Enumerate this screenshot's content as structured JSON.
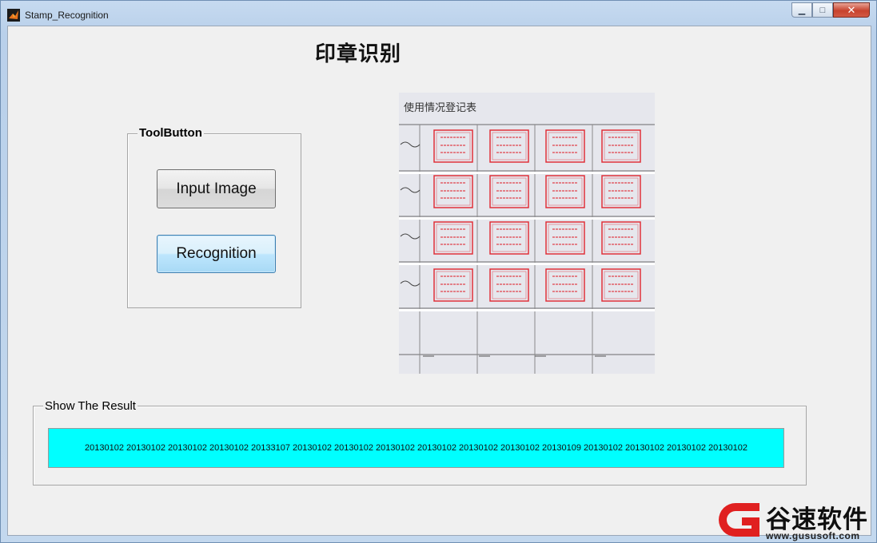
{
  "window": {
    "title": "Stamp_Recognition",
    "controls": {
      "minimize": "▁",
      "maximize": "□",
      "close": "✕"
    }
  },
  "main": {
    "heading": "印章识别",
    "toolbox": {
      "title": "ToolButton",
      "input_button": "Input Image",
      "recognition_button": "Recognition"
    },
    "result": {
      "title": "Show The Result",
      "value": "20130102 20130102 20130102 20130102 20133107 20130102 20130102 20130102 20130102 20130102 20130102 20130109 20130102 20130102 20130102 20130102"
    },
    "document_image": {
      "header": "使用情况登记表",
      "stamp_count": 16,
      "stamp_color": "#e0303a"
    }
  },
  "watermark": {
    "brand": "谷速软件",
    "url": "www.gususoft.com",
    "color": "#e02020"
  }
}
